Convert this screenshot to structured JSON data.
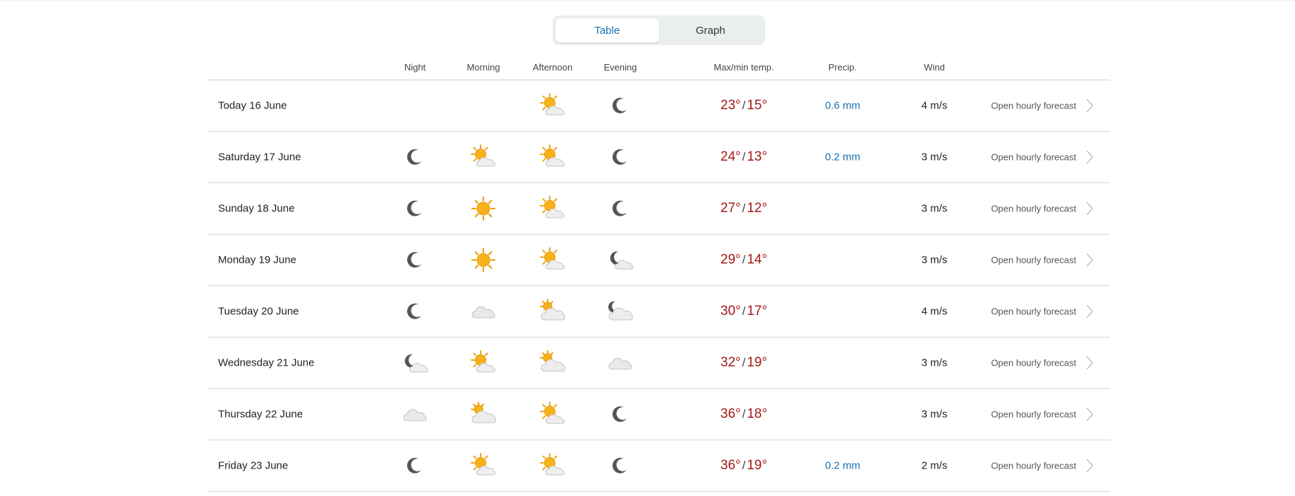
{
  "view_toggle": {
    "table_label": "Table",
    "graph_label": "Graph",
    "active": "table"
  },
  "columns": {
    "night": "Night",
    "morning": "Morning",
    "afternoon": "Afternoon",
    "evening": "Evening",
    "temp": "Max/min temp.",
    "precip": "Precip.",
    "wind": "Wind"
  },
  "colors": {
    "temperature": "#a21a1a",
    "precipitation": "#1a6fb0",
    "active_tab": "#1a6fb0"
  },
  "days": [
    {
      "day": "Today 16 June",
      "night": "",
      "morning": "",
      "afternoon": "partly-cloudy-sun-icon",
      "evening": "moon-icon",
      "max": "23°",
      "min": "15°",
      "precip": "0.6 mm",
      "wind": "4 m/s",
      "link": "Open hourly forecast"
    },
    {
      "day": "Saturday 17 June",
      "night": "moon-icon",
      "morning": "partly-cloudy-sun-icon",
      "afternoon": "partly-cloudy-sun-icon",
      "evening": "moon-icon",
      "max": "24°",
      "min": "13°",
      "precip": "0.2 mm",
      "wind": "3 m/s",
      "link": "Open hourly forecast"
    },
    {
      "day": "Sunday 18 June",
      "night": "moon-icon",
      "morning": "sun-icon",
      "afternoon": "partly-cloudy-sun-icon",
      "evening": "moon-icon",
      "max": "27°",
      "min": "12°",
      "precip": "",
      "wind": "3 m/s",
      "link": "Open hourly forecast"
    },
    {
      "day": "Monday 19 June",
      "night": "moon-icon",
      "morning": "sun-icon",
      "afternoon": "partly-cloudy-sun-icon",
      "evening": "partly-cloudy-moon-icon",
      "max": "29°",
      "min": "14°",
      "precip": "",
      "wind": "3 m/s",
      "link": "Open hourly forecast"
    },
    {
      "day": "Tuesday 20 June",
      "night": "moon-icon",
      "morning": "cloud-icon",
      "afternoon": "cloudy-sun-icon",
      "evening": "cloudy-moon-icon",
      "max": "30°",
      "min": "17°",
      "precip": "",
      "wind": "4 m/s",
      "link": "Open hourly forecast"
    },
    {
      "day": "Wednesday 21 June",
      "night": "partly-cloudy-moon-icon",
      "morning": "partly-cloudy-sun-icon",
      "afternoon": "cloudy-sun-icon",
      "evening": "cloud-icon",
      "max": "32°",
      "min": "19°",
      "precip": "",
      "wind": "3 m/s",
      "link": "Open hourly forecast"
    },
    {
      "day": "Thursday 22 June",
      "night": "cloud-icon",
      "morning": "cloudy-sun-icon",
      "afternoon": "partly-cloudy-sun-icon",
      "evening": "moon-icon",
      "max": "36°",
      "min": "18°",
      "precip": "",
      "wind": "3 m/s",
      "link": "Open hourly forecast"
    },
    {
      "day": "Friday 23 June",
      "night": "moon-icon",
      "morning": "partly-cloudy-sun-icon",
      "afternoon": "partly-cloudy-sun-icon",
      "evening": "moon-icon",
      "max": "36°",
      "min": "19°",
      "precip": "0.2 mm",
      "wind": "2 m/s",
      "link": "Open hourly forecast"
    }
  ]
}
